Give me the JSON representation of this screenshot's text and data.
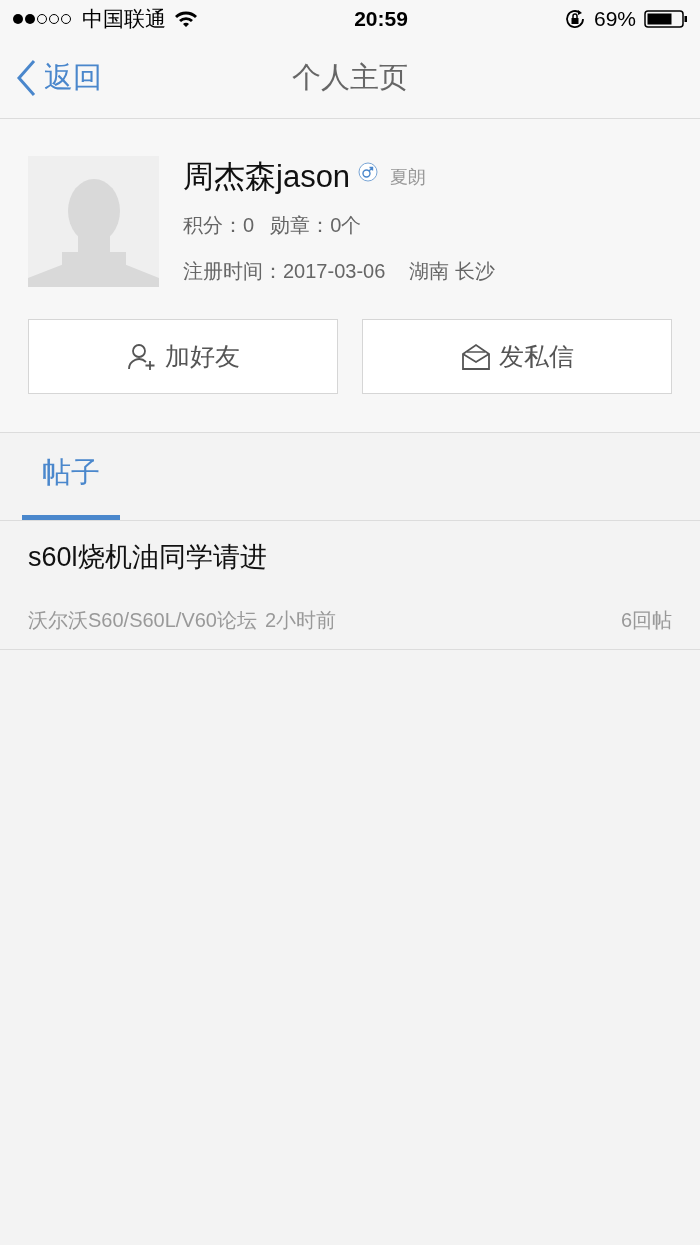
{
  "status_bar": {
    "carrier": "中国联通",
    "time": "20:59",
    "battery": "69%"
  },
  "nav": {
    "back": "返回",
    "title": "个人主页"
  },
  "profile": {
    "name": "周杰森jason",
    "level": "夏朗",
    "points": "积分：0",
    "medals": "勋章：0个",
    "registered": "注册时间：2017-03-06",
    "location": "湖南 长沙"
  },
  "actions": [
    {
      "kind": "add-friend",
      "label": "加好友"
    },
    {
      "kind": "message",
      "label": "发私信"
    }
  ],
  "tabs": [
    {
      "label": "帖子",
      "selected": true
    }
  ],
  "posts": [
    {
      "title": "s60l烧机油同学请进",
      "forum": "沃尔沃S60/S60L/V60论坛",
      "time": "2小时前",
      "replies": "6回帖"
    }
  ]
}
